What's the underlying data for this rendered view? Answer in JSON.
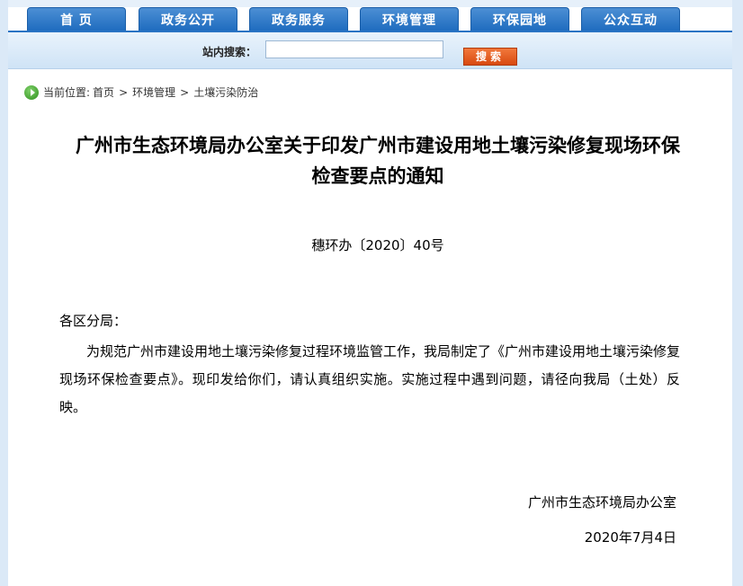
{
  "nav": {
    "tabs": [
      "首  页",
      "政务公开",
      "政务服务",
      "环境管理",
      "环保园地",
      "公众互动"
    ]
  },
  "search": {
    "label": "站内搜索：",
    "value": "",
    "button": "搜索"
  },
  "breadcrumb": {
    "prefix": "当前位置:",
    "items": [
      "首页",
      "环境管理",
      "土壤污染防治"
    ],
    "separator": ">"
  },
  "article": {
    "title_line1": "广州市生态环境局办公室关于印发广州市建设用地土壤污染修复现场环保",
    "title_line2": "检查要点的通知",
    "doc_number": "穗环办〔2020〕40号",
    "salutation": "各区分局：",
    "body": "为规范广州市建设用地土壤污染修复过程环境监管工作，我局制定了《广州市建设用地土壤污染修复现场环保检查要点》。现印发给你们，请认真组织实施。实施过程中遇到问题，请径向我局（土处）反映。",
    "signature_org": "广州市生态环境局办公室",
    "signature_date": "2020年7月4日"
  },
  "colors": {
    "nav_tab": "#2a74c4",
    "search_button": "#e0561a",
    "border": "#dbe9f7"
  }
}
